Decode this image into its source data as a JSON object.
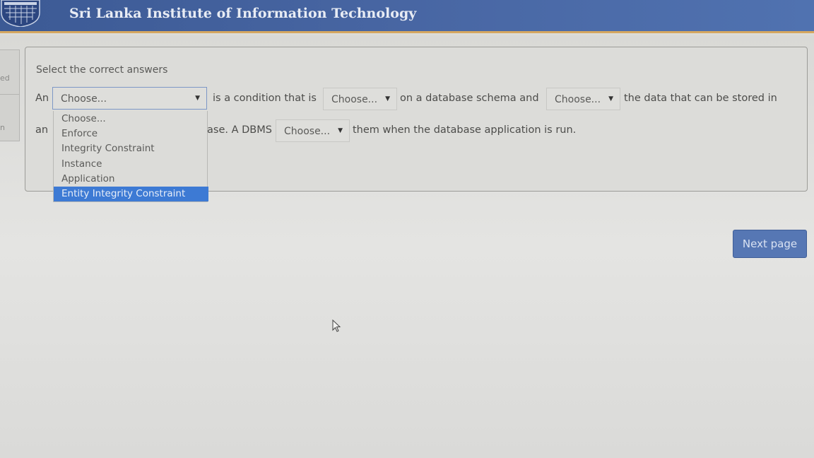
{
  "header": {
    "title": "Sri Lanka Institute of Information Technology"
  },
  "left_nav": {
    "item1": "ed",
    "item2": "n"
  },
  "question": {
    "prompt": "Select the correct answers",
    "line1": {
      "word_an": "An",
      "text1": "is a condition that is",
      "text2": "on a database schema and",
      "text3": "the data that can be stored in"
    },
    "line2": {
      "word_an": "an",
      "text1": "ase. A DBMS",
      "text2": "them when the database application is run."
    },
    "selects": {
      "s1": "Choose...",
      "s2": "Choose...",
      "s3": "Choose...",
      "s4": "Choose..."
    },
    "dropdown_options": [
      "Choose...",
      "Enforce",
      "Integrity Constraint",
      "Instance",
      "Application",
      "Entity Integrity Constraint"
    ],
    "highlighted_option": "Entity Integrity Constraint"
  },
  "buttons": {
    "next": "Next page"
  },
  "colors": {
    "header": "#4866a3",
    "accent_line": "#d5a760",
    "selected_option": "#3d7ad4",
    "next_button": "#5677b4"
  },
  "icons": {
    "dropdown_arrow": "▼",
    "cursor": "mouse-pointer"
  }
}
